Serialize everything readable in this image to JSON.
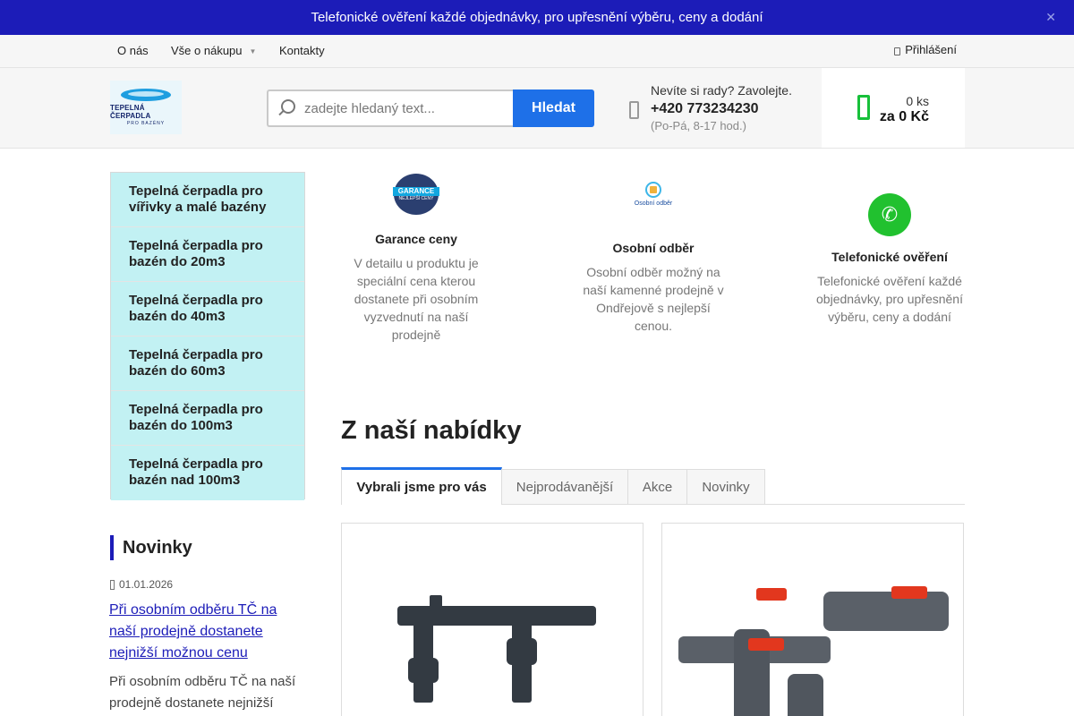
{
  "announcement": {
    "text": "Telefonické ověření každé objednávky, pro upřesnění výběru, ceny a dodání",
    "close": "✕"
  },
  "nav": {
    "items": [
      "O nás",
      "Vše o nákupu",
      "Kontakty"
    ],
    "login": "Přihlášení"
  },
  "logo": {
    "title": "TEPELNÁ ČERPADLA",
    "subtitle": "PRO BAZÉNY"
  },
  "search": {
    "placeholder": "zadejte hledaný text...",
    "button": "Hledat"
  },
  "contact": {
    "prompt": "Nevíte si rady? Zavolejte.",
    "phone": "+420 773234230",
    "hours": "(Po-Pá, 8-17 hod.)"
  },
  "cart": {
    "count": "0 ks",
    "total": "za 0 Kč"
  },
  "categories": [
    "Tepelná čerpadla pro vířivky a malé bazény",
    "Tepelná čerpadla pro bazén do 20m3",
    "Tepelná čerpadla pro bazén do 40m3",
    "Tepelná čerpadla pro bazén do 60m3",
    "Tepelná čerpadla pro bazén do 100m3",
    "Tepelná čerpadla pro bazén nad 100m3"
  ],
  "news": {
    "heading": "Novinky",
    "date": "01.01.2026",
    "title": "Při osobním odběru TČ na naší prodejně dostanete nejnižší možnou cenu",
    "excerpt": "Při osobním odběru TČ na naší prodejně dostanete nejnižší"
  },
  "benefits": [
    {
      "badge_main": "GARANCE",
      "badge_sub": "NEJLEPŠÍ CENY",
      "title": "Garance ceny",
      "text": "V detailu u produktu je speciální cena kterou dostanete při osobním vyzvednutí na naší prodejně"
    },
    {
      "badge_main": "Osobní odběr",
      "title": "Osobní odběr",
      "text": "Osobní odběr možný na naší kamenné prodejně v Ondřejově s nejlepší cenou."
    },
    {
      "title": "Telefonické ověření",
      "text": "Telefonické ověření každé objednávky, pro upřesnění výběru, ceny a dodání"
    }
  ],
  "offer": {
    "heading": "Z naší nabídky",
    "tabs": [
      "Vybrali jsme pro vás",
      "Nejprodávanější",
      "Akce",
      "Novinky"
    ]
  },
  "colors": {
    "primary": "#1c1cb8",
    "button": "#1e70e8",
    "category_bg": "#c2f1f3",
    "cart_green": "#17c03a"
  }
}
